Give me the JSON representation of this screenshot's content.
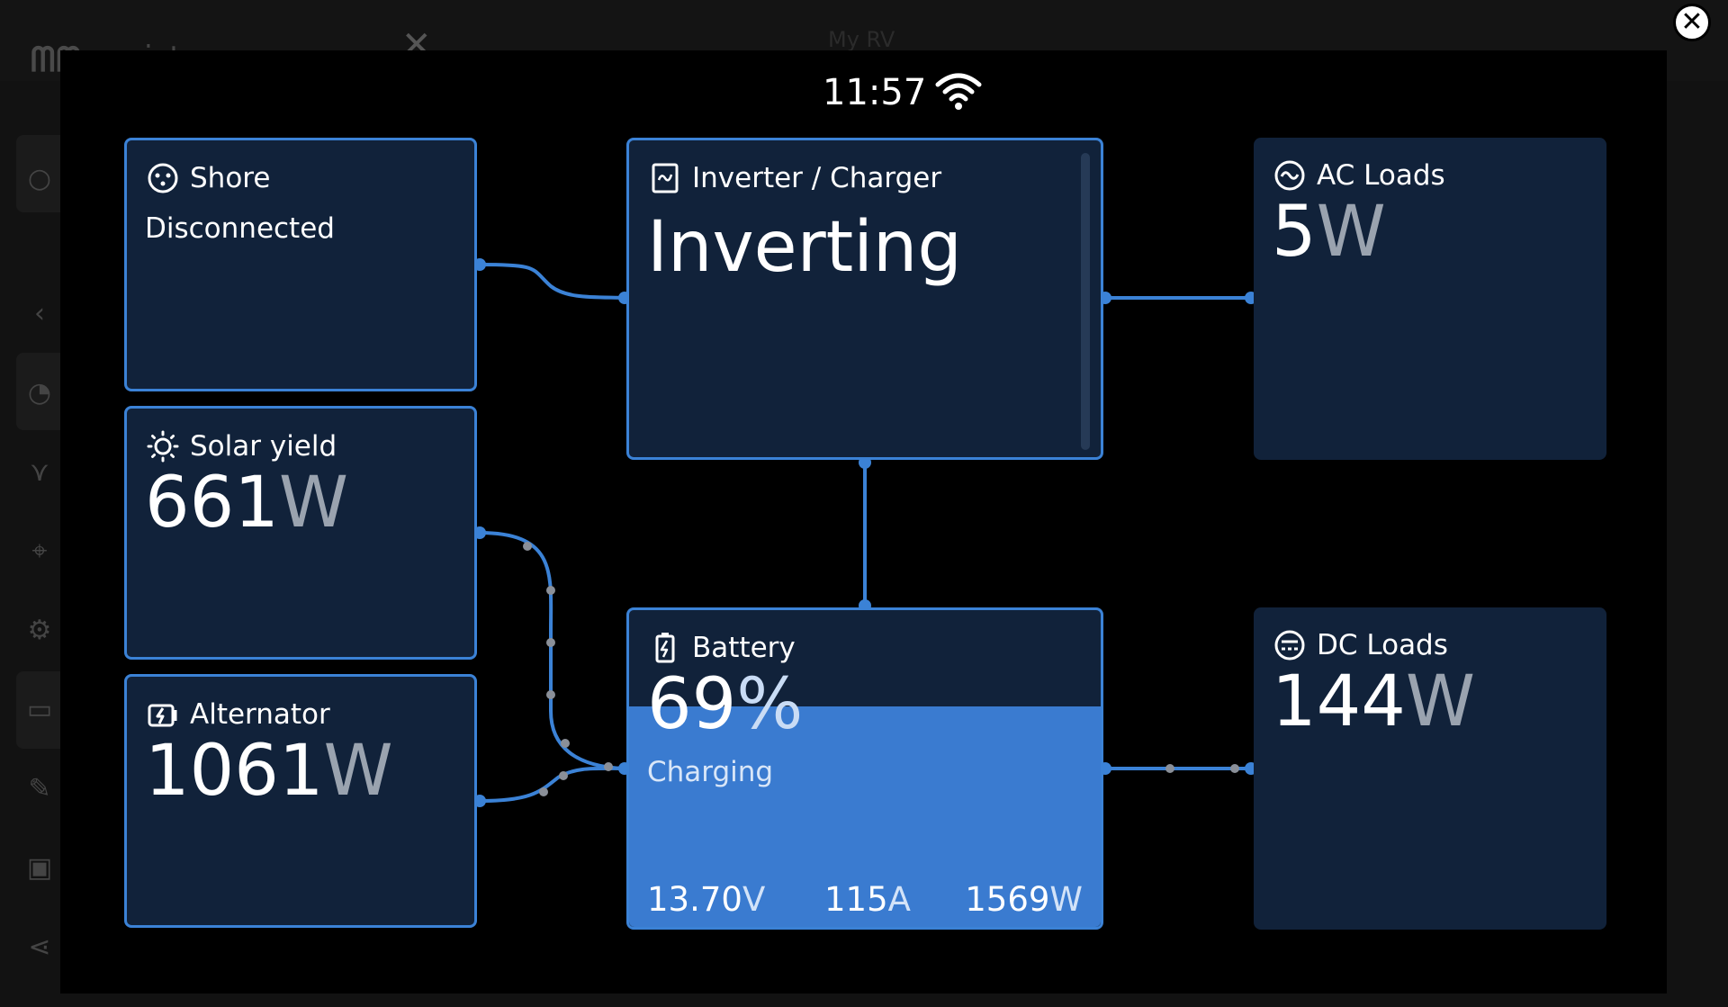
{
  "background_app": {
    "logo_text": "victron energy",
    "breadcrumb": "My RV"
  },
  "status_bar": {
    "time": "11:57",
    "wifi_icon": "wifi-icon"
  },
  "tiles": {
    "shore": {
      "title": "Shore",
      "status": "Disconnected",
      "icon": "shore-plug-icon"
    },
    "solar": {
      "title": "Solar yield",
      "value": "661",
      "unit": "W",
      "icon": "sun-icon"
    },
    "alternator": {
      "title": "Alternator",
      "value": "1061",
      "unit": "W",
      "icon": "alternator-icon"
    },
    "inverter": {
      "title": "Inverter / Charger",
      "state": "Inverting",
      "icon": "inverter-icon"
    },
    "battery": {
      "title": "Battery",
      "soc_value": "69",
      "soc_unit": "%",
      "state": "Charging",
      "soc_fraction": 0.69,
      "voltage": "13.70",
      "voltage_unit": "V",
      "current": "115",
      "current_unit": "A",
      "power": "1569",
      "power_unit": "W",
      "icon": "battery-charging-icon"
    },
    "ac_loads": {
      "title": "AC Loads",
      "value": "5",
      "unit": "W",
      "icon": "ac-sine-icon"
    },
    "dc_loads": {
      "title": "DC Loads",
      "value": "144",
      "unit": "W",
      "icon": "dc-icon"
    }
  },
  "colors": {
    "tile_bg": "#11223a",
    "accent": "#3b82d6",
    "battery_fill": "#3a7bd0"
  }
}
